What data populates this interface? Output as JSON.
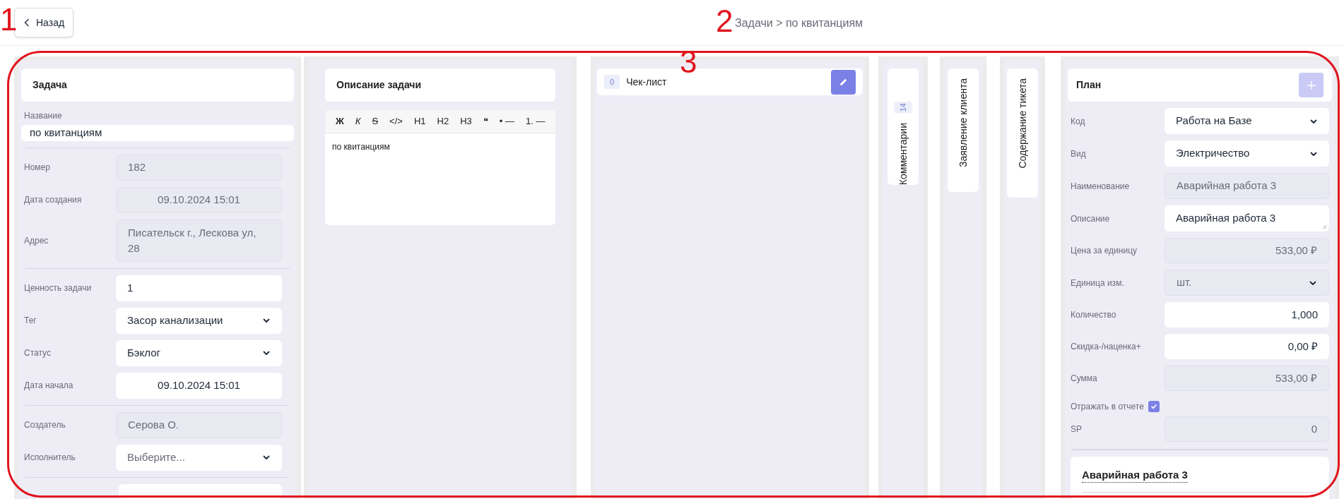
{
  "header": {
    "back_button": "Назад",
    "title": "Задачи > по квитанциям"
  },
  "annotations": [
    {
      "label": "1"
    },
    {
      "label": "2"
    },
    {
      "label": "3"
    }
  ],
  "task_panel": {
    "title": "Задача",
    "name_label": "Название",
    "name_value": "по квитанциям",
    "groups": [
      [
        {
          "label": "Номер",
          "value": "182",
          "kind": "text",
          "disabled": true
        },
        {
          "label": "Дата создания",
          "value": "09.10.2024 15:01",
          "kind": "date",
          "disabled": true
        },
        {
          "label": "Адрес",
          "value": "Писательск г., Лескова ул, 28",
          "kind": "text",
          "disabled": true
        }
      ],
      [
        {
          "label": "Ценность задачи",
          "value": "1",
          "kind": "text",
          "disabled": false
        },
        {
          "label": "Тег",
          "value": "Засор канализации",
          "kind": "select",
          "disabled": false
        },
        {
          "label": "Статус",
          "value": "Бэклог",
          "kind": "select",
          "disabled": false
        },
        {
          "label": "Дата начала",
          "value": "09.10.2024 15:01",
          "kind": "date",
          "disabled": false
        }
      ],
      [
        {
          "label": "Создатель",
          "value": "Серова О.",
          "kind": "text",
          "disabled": true
        },
        {
          "label": "Исполнитель",
          "placeholder": "Выберите...",
          "kind": "select",
          "disabled": false
        }
      ]
    ]
  },
  "description_panel": {
    "title": "Описание задачи",
    "toolbar": [
      "Ж",
      "К",
      "S",
      "</>",
      "H1",
      "H2",
      "H3",
      "❝",
      "• —",
      "1. —"
    ],
    "content": "по квитанциям"
  },
  "checklist_panel": {
    "count": "0",
    "title": "Чек-лист"
  },
  "side_tabs": [
    {
      "label": "Комментарии",
      "count": "14"
    },
    {
      "label": "Заявление клиента"
    },
    {
      "label": "Содержание тикета"
    }
  ],
  "plan_panel": {
    "title": "План",
    "add_disabled": true,
    "fields": [
      {
        "label": "Код",
        "value": "Работа на Базе",
        "kind": "select",
        "disabled": false
      },
      {
        "label": "Вид",
        "value": "Электричество",
        "kind": "select",
        "disabled": false
      },
      {
        "label": "Наименование",
        "value": "Аварийная работа 3",
        "kind": "text",
        "disabled": true
      },
      {
        "label": "Описание",
        "value": "Аварийная работа 3",
        "kind": "textarea",
        "disabled": false
      },
      {
        "label": "Цена за единицу",
        "value": "533,00 ₽",
        "kind": "number",
        "disabled": true
      },
      {
        "label": "Единица изм.",
        "value": "шт.",
        "kind": "select",
        "disabled": true
      },
      {
        "label": "Количество",
        "value": "1,000",
        "kind": "number",
        "disabled": false
      },
      {
        "label": "Скидка-/наценка+",
        "value": "0,00 ₽",
        "kind": "number",
        "disabled": false
      },
      {
        "label": "Сумма",
        "value": "533,00 ₽",
        "kind": "number",
        "disabled": true
      },
      {
        "label": "Отражать в отчете",
        "kind": "checkbox",
        "checked": true
      },
      {
        "label": "SP",
        "value": "0",
        "kind": "number",
        "disabled": true
      }
    ],
    "item_title": "Аварийная работа 3"
  }
}
